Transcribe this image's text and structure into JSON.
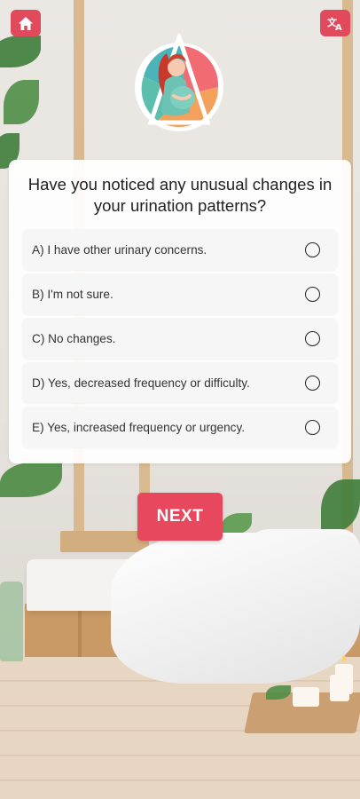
{
  "header": {
    "home_icon": "home-icon",
    "translate_icon": "translate-icon"
  },
  "logo": {
    "icon": "pregnant-woman-illustration"
  },
  "quiz": {
    "question": "Have you noticed any unusual changes in your urination patterns?",
    "options": [
      {
        "label": "A) I have other urinary concerns."
      },
      {
        "label": "B) I'm not sure."
      },
      {
        "label": "C) No changes."
      },
      {
        "label": "D) Yes, decreased frequency or difficulty."
      },
      {
        "label": "E) Yes, increased frequency or urgency."
      }
    ],
    "next_label": "NEXT"
  },
  "colors": {
    "accent": "#e8485e",
    "icon_button": "#e04a5c",
    "card_background": "#ffffff",
    "option_background": "#f6f6f6"
  }
}
